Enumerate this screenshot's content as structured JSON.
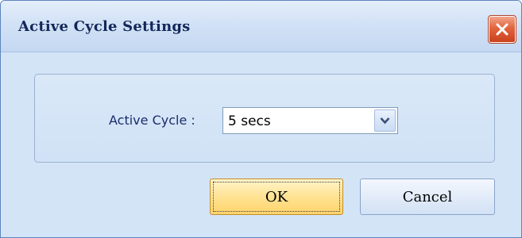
{
  "window": {
    "title": "Active Cycle Settings"
  },
  "form": {
    "active_cycle_label": "Active Cycle :",
    "active_cycle_value": "5 secs"
  },
  "buttons": {
    "ok_label": "OK",
    "cancel_label": "Cancel"
  },
  "icons": {
    "close": "close-icon",
    "dropdown": "chevron-down-icon"
  },
  "colors": {
    "title_text": "#13275a",
    "close_button": "#e2643e",
    "ok_button": "#ffe18f"
  }
}
